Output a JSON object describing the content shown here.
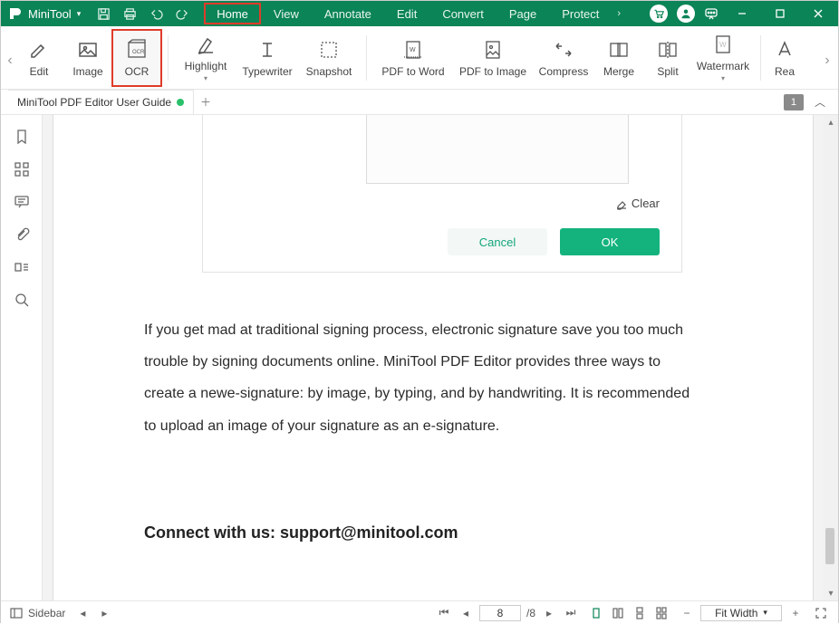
{
  "app": {
    "brand": "MiniTool"
  },
  "menus": {
    "items": [
      "Home",
      "View",
      "Annotate",
      "Edit",
      "Convert",
      "Page",
      "Protect"
    ],
    "active_index": 0
  },
  "ribbon": {
    "items": [
      {
        "label": "Edit",
        "icon": "edit"
      },
      {
        "label": "Image",
        "icon": "image"
      },
      {
        "label": "OCR",
        "icon": "ocr",
        "highlighted": true
      },
      {
        "label": "Highlight",
        "icon": "highlight",
        "dropdown": true
      },
      {
        "label": "Typewriter",
        "icon": "typewriter"
      },
      {
        "label": "Snapshot",
        "icon": "snapshot"
      },
      {
        "label": "PDF to Word",
        "icon": "pdf2word"
      },
      {
        "label": "PDF to Image",
        "icon": "pdf2image"
      },
      {
        "label": "Compress",
        "icon": "compress"
      },
      {
        "label": "Merge",
        "icon": "merge"
      },
      {
        "label": "Split",
        "icon": "split"
      },
      {
        "label": "Watermark",
        "icon": "watermark",
        "dropdown": true
      },
      {
        "label": "Rea",
        "icon": "font"
      }
    ]
  },
  "tabs": {
    "open": [
      {
        "title": "MiniTool PDF Editor User Guide",
        "modified": true
      }
    ],
    "page_indicator": "1"
  },
  "dialog": {
    "clear_label": "Clear",
    "cancel_label": "Cancel",
    "ok_label": "OK"
  },
  "page_content": {
    "paragraph": "If you get mad at traditional signing process, electronic signature save you too much trouble by signing documents online. MiniTool PDF Editor provides three ways to create a newe-signature: by image, by typing, and by handwriting. It is recommended to upload an image of your signature as an e-signature.",
    "contact_heading": "Connect with us: support@minitool.com"
  },
  "status": {
    "sidebar_label": "Sidebar",
    "current_page": "8",
    "total_pages": "/8",
    "zoom_label": "Fit Width"
  },
  "colors": {
    "brand_green": "#0b8457",
    "accent_green": "#14b37d",
    "highlight_red": "#e03b2a"
  }
}
